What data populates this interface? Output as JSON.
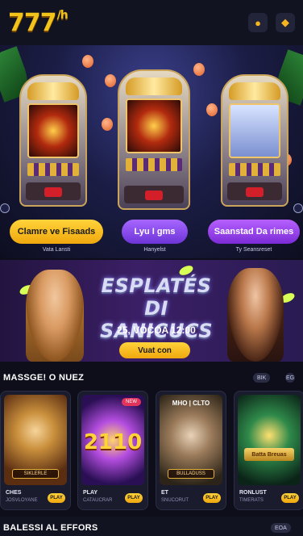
{
  "header": {
    "logo_main": "777",
    "logo_suffix": "/h",
    "icon_left": "coin-icon",
    "icon_right": "chest-icon"
  },
  "hero": {
    "cta_buttons": [
      {
        "label": "Clamre ve Fisaads",
        "caption": "Vata Lansti"
      },
      {
        "label": "Lyu I gms",
        "caption": "Hanyelst"
      },
      {
        "label": "Saanstad Da rimes",
        "caption": "Ty Seansreset"
      }
    ]
  },
  "banner": {
    "title_line1": "ESPLATÉS DI",
    "title_line2": "SANICUCS",
    "time": "25, VOCOA 12:00",
    "cta": "Vuat con"
  },
  "section1": {
    "title": "MASSGE! O NUEZ",
    "pill_label": "BIK",
    "dot_label": "EG",
    "cards": [
      {
        "name": "CHES",
        "sub": "JOSVLOYANE",
        "art_label": "SIKLERLE",
        "play": "PLAY"
      },
      {
        "name": "PLAY",
        "sub": "CATAUCRAR",
        "art_label": "",
        "badge": "NEW",
        "big": "2110",
        "play": "PLAY"
      },
      {
        "name": "ET",
        "sub": "SNUCORUT",
        "art_label": "BULLADUSS",
        "top": "MHO | CLTO",
        "play": "PLAY"
      },
      {
        "name": "RONLUST",
        "sub": "TIMERATS",
        "art_label": "",
        "ribbon": "Batta Breuas",
        "play": "PLAY"
      }
    ]
  },
  "section2": {
    "title": "BALESSI AL EFFORS",
    "pill_label": "EOA"
  }
}
